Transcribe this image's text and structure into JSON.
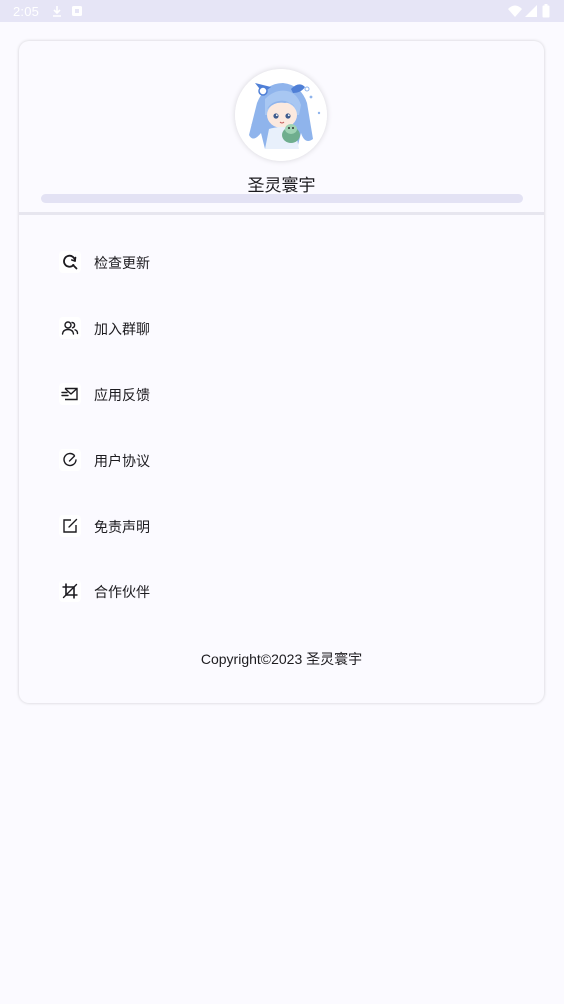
{
  "status_bar": {
    "time": "2:05",
    "icons": [
      "download-icon",
      "notification-icon",
      "wifi-icon",
      "signal-icon",
      "battery-icon"
    ]
  },
  "profile": {
    "name": "圣灵寰宇",
    "avatar": "anime-girl-avatar",
    "progress": 0
  },
  "menu": {
    "items": [
      {
        "label": "检查更新",
        "icon": "refresh-search-icon"
      },
      {
        "label": "加入群聊",
        "icon": "users-icon"
      },
      {
        "label": "应用反馈",
        "icon": "mail-icon"
      },
      {
        "label": "用户协议",
        "icon": "check-circle-icon"
      },
      {
        "label": "免责声明",
        "icon": "edit-icon"
      },
      {
        "label": "合作伙伴",
        "icon": "crop-icon"
      }
    ]
  },
  "footer": {
    "copyright": "Copyright©2023 圣灵寰宇"
  },
  "colors": {
    "background": "#fbfaff",
    "status_bar": "#e6e5f6",
    "progress_track": "#e3e2f4",
    "text": "#1c1b1f"
  }
}
